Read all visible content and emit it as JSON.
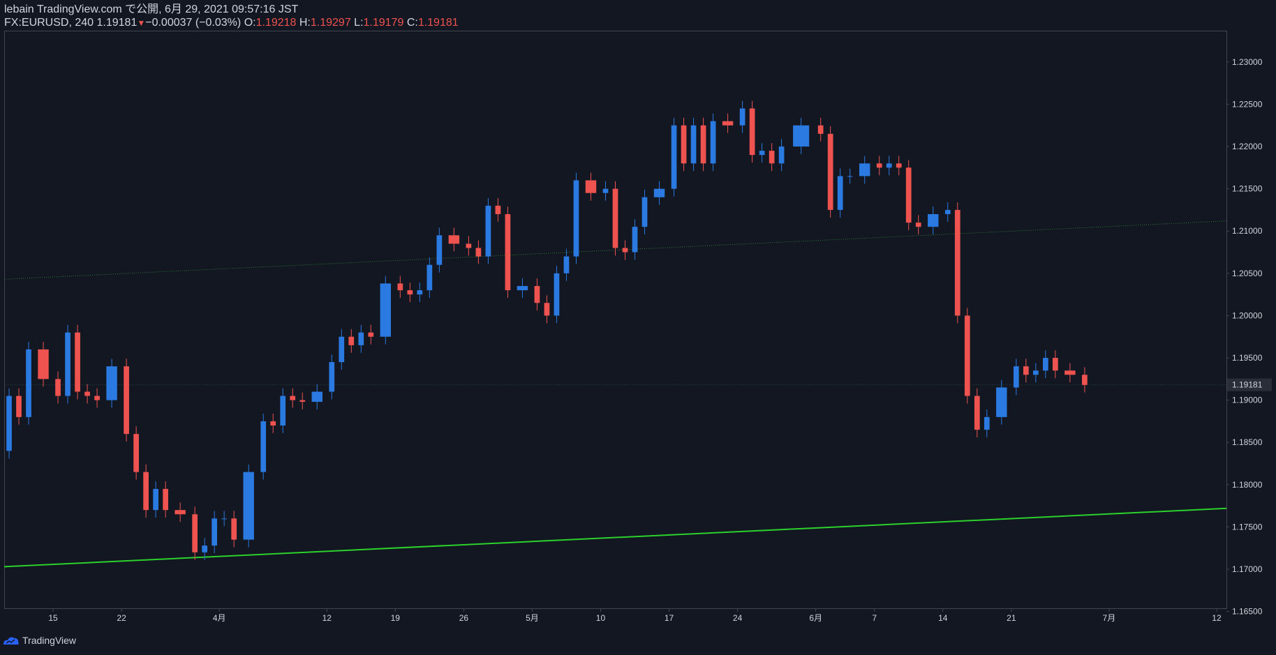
{
  "header": {
    "line1": "lebain TradingView.com で公開, 6月 29, 2021 09:57:16 JST",
    "symbol": "FX:EURUSD, 240",
    "last": "1.19181",
    "arrow": "▼",
    "change": "−0.00037 (−0.03%)",
    "o_label": "O:",
    "o_val": "1.19218",
    "h_label": "H:",
    "h_val": "1.19297",
    "l_label": "L:",
    "l_val": "1.19179",
    "c_label": "C:",
    "c_val": "1.19181"
  },
  "footer": {
    "brand": "TradingView"
  },
  "colors": {
    "background": "#131722",
    "up": "#2a7ae2",
    "down": "#ef5350",
    "trendline": "#2bd22b",
    "channel_dotted": "#2e7d32",
    "price_line": "#1f4a3a",
    "price_badge": "#2a2e39"
  },
  "chart_data": {
    "type": "candlestick",
    "symbol": "FX:EURUSD",
    "interval": "240",
    "y_ticks": [
      "1.23000",
      "1.22500",
      "1.22000",
      "1.21500",
      "1.21000",
      "1.20500",
      "1.20000",
      "1.19500",
      "1.19000",
      "1.18500",
      "1.18000",
      "1.17500",
      "1.17000",
      "1.16500"
    ],
    "ylim": [
      1.1653,
      1.2337
    ],
    "x_ticks": [
      {
        "label": "15",
        "x": "2021-03-15"
      },
      {
        "label": "22",
        "x": "2021-03-22"
      },
      {
        "label": "4月",
        "x": "2021-04-01"
      },
      {
        "label": "12",
        "x": "2021-04-12"
      },
      {
        "label": "19",
        "x": "2021-04-19"
      },
      {
        "label": "26",
        "x": "2021-04-26"
      },
      {
        "label": "5月",
        "x": "2021-05-03"
      },
      {
        "label": "10",
        "x": "2021-05-10"
      },
      {
        "label": "17",
        "x": "2021-05-17"
      },
      {
        "label": "24",
        "x": "2021-05-24"
      },
      {
        "label": "6月",
        "x": "2021-06-01"
      },
      {
        "label": "7",
        "x": "2021-06-07"
      },
      {
        "label": "14",
        "x": "2021-06-14"
      },
      {
        "label": "21",
        "x": "2021-06-21"
      },
      {
        "label": "7月",
        "x": "2021-07-01"
      },
      {
        "label": "12",
        "x": "2021-07-12"
      }
    ],
    "last_price": "1.19181",
    "trend_support": {
      "start": {
        "x": "2021-03-10",
        "y": 1.1703
      },
      "end": {
        "x": "2021-07-13",
        "y": 1.1772
      }
    },
    "trend_channel_upper": {
      "start": {
        "x": "2021-03-10",
        "y": 1.2043
      },
      "end": {
        "x": "2021-07-13",
        "y": 1.2112
      }
    },
    "closes": [
      [
        "2021-03-10",
        1.184
      ],
      [
        "2021-03-11",
        1.1905
      ],
      [
        "2021-03-12",
        1.188
      ],
      [
        "2021-03-13",
        1.196
      ],
      [
        "2021-03-15",
        1.1925
      ],
      [
        "2021-03-16",
        1.1905
      ],
      [
        "2021-03-17",
        1.198
      ],
      [
        "2021-03-18",
        1.191
      ],
      [
        "2021-03-19",
        1.1905
      ],
      [
        "2021-03-20",
        1.19
      ],
      [
        "2021-03-22",
        1.194
      ],
      [
        "2021-03-23",
        1.186
      ],
      [
        "2021-03-24",
        1.1815
      ],
      [
        "2021-03-25",
        1.177
      ],
      [
        "2021-03-26",
        1.1795
      ],
      [
        "2021-03-27",
        1.177
      ],
      [
        "2021-03-29",
        1.1765
      ],
      [
        "2021-03-30",
        1.172
      ],
      [
        "2021-03-31",
        1.1728
      ],
      [
        "2021-04-01",
        1.176
      ],
      [
        "2021-04-02",
        1.176
      ],
      [
        "2021-04-03",
        1.1735
      ],
      [
        "2021-04-05",
        1.1815
      ],
      [
        "2021-04-06",
        1.1875
      ],
      [
        "2021-04-07",
        1.187
      ],
      [
        "2021-04-08",
        1.1905
      ],
      [
        "2021-04-09",
        1.19
      ],
      [
        "2021-04-10",
        1.1898
      ],
      [
        "2021-04-12",
        1.191
      ],
      [
        "2021-04-13",
        1.1945
      ],
      [
        "2021-04-14",
        1.1975
      ],
      [
        "2021-04-15",
        1.1965
      ],
      [
        "2021-04-16",
        1.198
      ],
      [
        "2021-04-17",
        1.1975
      ],
      [
        "2021-04-19",
        1.2038
      ],
      [
        "2021-04-20",
        1.203
      ],
      [
        "2021-04-21",
        1.2025
      ],
      [
        "2021-04-22",
        1.203
      ],
      [
        "2021-04-23",
        1.206
      ],
      [
        "2021-04-24",
        1.2095
      ],
      [
        "2021-04-26",
        1.2085
      ],
      [
        "2021-04-27",
        1.208
      ],
      [
        "2021-04-28",
        1.207
      ],
      [
        "2021-04-29",
        1.213
      ],
      [
        "2021-04-30",
        1.212
      ],
      [
        "2021-05-01",
        1.203
      ],
      [
        "2021-05-03",
        1.2035
      ],
      [
        "2021-05-04",
        1.2015
      ],
      [
        "2021-05-05",
        1.2
      ],
      [
        "2021-05-06",
        1.205
      ],
      [
        "2021-05-07",
        1.207
      ],
      [
        "2021-05-08",
        1.216
      ],
      [
        "2021-05-10",
        1.2145
      ],
      [
        "2021-05-11",
        1.215
      ],
      [
        "2021-05-12",
        1.208
      ],
      [
        "2021-05-13",
        1.2075
      ],
      [
        "2021-05-14",
        1.2105
      ],
      [
        "2021-05-15",
        1.214
      ],
      [
        "2021-05-17",
        1.215
      ],
      [
        "2021-05-18",
        1.2225
      ],
      [
        "2021-05-19",
        1.218
      ],
      [
        "2021-05-20",
        1.2225
      ],
      [
        "2021-05-21",
        1.218
      ],
      [
        "2021-05-22",
        1.223
      ],
      [
        "2021-05-24",
        1.2225
      ],
      [
        "2021-05-25",
        1.2245
      ],
      [
        "2021-05-26",
        1.219
      ],
      [
        "2021-05-27",
        1.2195
      ],
      [
        "2021-05-28",
        1.218
      ],
      [
        "2021-05-29",
        1.22
      ],
      [
        "2021-06-01",
        1.2225
      ],
      [
        "2021-06-02",
        1.2215
      ],
      [
        "2021-06-03",
        1.2125
      ],
      [
        "2021-06-04",
        1.2165
      ],
      [
        "2021-06-05",
        1.2165
      ],
      [
        "2021-06-07",
        1.218
      ],
      [
        "2021-06-08",
        1.2175
      ],
      [
        "2021-06-09",
        1.218
      ],
      [
        "2021-06-10",
        1.2175
      ],
      [
        "2021-06-11",
        1.211
      ],
      [
        "2021-06-12",
        1.2105
      ],
      [
        "2021-06-14",
        1.212
      ],
      [
        "2021-06-15",
        1.2125
      ],
      [
        "2021-06-16",
        1.2
      ],
      [
        "2021-06-17",
        1.1905
      ],
      [
        "2021-06-18",
        1.1865
      ],
      [
        "2021-06-19",
        1.188
      ],
      [
        "2021-06-21",
        1.1915
      ],
      [
        "2021-06-22",
        1.194
      ],
      [
        "2021-06-23",
        1.193
      ],
      [
        "2021-06-24",
        1.1935
      ],
      [
        "2021-06-25",
        1.195
      ],
      [
        "2021-06-26",
        1.1935
      ],
      [
        "2021-06-28",
        1.193
      ],
      [
        "2021-06-29",
        1.1918
      ]
    ]
  }
}
